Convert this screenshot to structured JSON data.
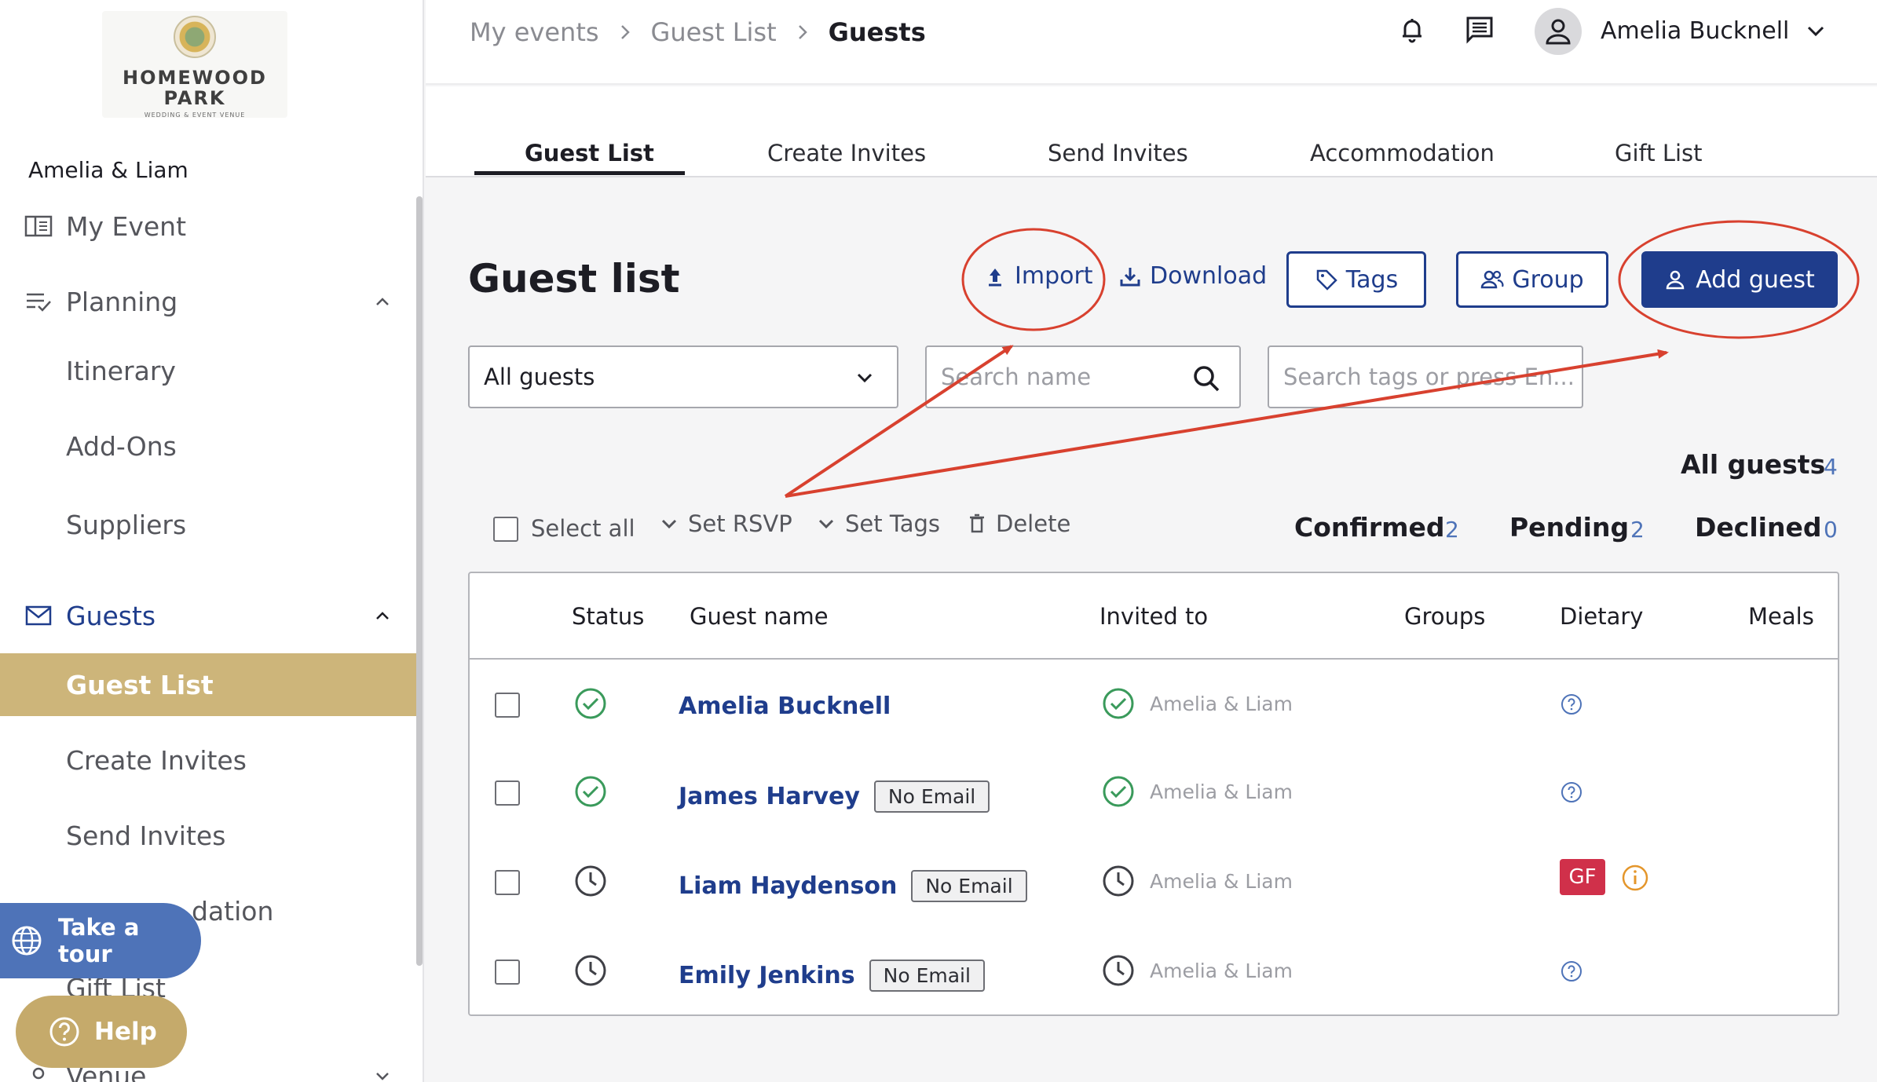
{
  "logo": {
    "line1": "HOMEWOOD",
    "line2": "PARK",
    "line3": "WEDDING & EVENT VENUE"
  },
  "sidebar": {
    "couple": "Amelia & Liam",
    "my_event": "My Event",
    "planning": "Planning",
    "itinerary": "Itinerary",
    "addons": "Add-Ons",
    "suppliers": "Suppliers",
    "guests": "Guests",
    "guest_list": "Guest List",
    "create_invites": "Create Invites",
    "send_invites": "Send Invites",
    "accommodation_partial": "dation",
    "gift_list_partial": "Gift List",
    "venue_partial": "Venue",
    "take_tour": "Take a tour",
    "help": "Help"
  },
  "breadcrumbs": [
    "My events",
    "Guest List",
    "Guests"
  ],
  "user": {
    "name": "Amelia Bucknell"
  },
  "tabs": [
    "Guest List",
    "Create Invites",
    "Send Invites",
    "Accommodation",
    "Gift List"
  ],
  "main": {
    "title": "Guest list",
    "import": "Import",
    "download": "Download",
    "tags": "Tags",
    "group": "Group",
    "add_guest": "Add guest",
    "filter_value": "All guests",
    "search_name_placeholder": "Search name",
    "search_tags_placeholder": "Search tags or press En..."
  },
  "counts": {
    "all_label": "All guests",
    "all": "4",
    "confirmed_label": "Confirmed",
    "confirmed": "2",
    "pending_label": "Pending",
    "pending": "2",
    "declined_label": "Declined",
    "declined": "0"
  },
  "bulk": {
    "select_all": "Select all",
    "set_rsvp": "Set RSVP",
    "set_tags": "Set Tags",
    "delete": "Delete"
  },
  "table": {
    "columns": [
      "Status",
      "Guest name",
      "Invited to",
      "Groups",
      "Dietary",
      "Meals"
    ],
    "rows": [
      {
        "status": "confirmed",
        "name": "Amelia Bucknell",
        "badge": "",
        "invited_to": "Amelia & Liam",
        "dietary": "unknown"
      },
      {
        "status": "confirmed",
        "name": "James Harvey",
        "badge": "No Email",
        "invited_to": "Amelia & Liam",
        "dietary": "unknown"
      },
      {
        "status": "pending",
        "name": "Liam Haydenson",
        "badge": "No Email",
        "invited_to": "Amelia & Liam",
        "dietary": "GF"
      },
      {
        "status": "pending",
        "name": "Emily Jenkins",
        "badge": "No Email",
        "invited_to": "Amelia & Liam",
        "dietary": "unknown"
      }
    ]
  },
  "colors": {
    "primary": "#1f3d8c",
    "accent_gold": "#cdb57a",
    "confirmed_green": "#3a9a5b",
    "annotation_red": "#d8412f",
    "gf_badge": "#d0304a"
  }
}
